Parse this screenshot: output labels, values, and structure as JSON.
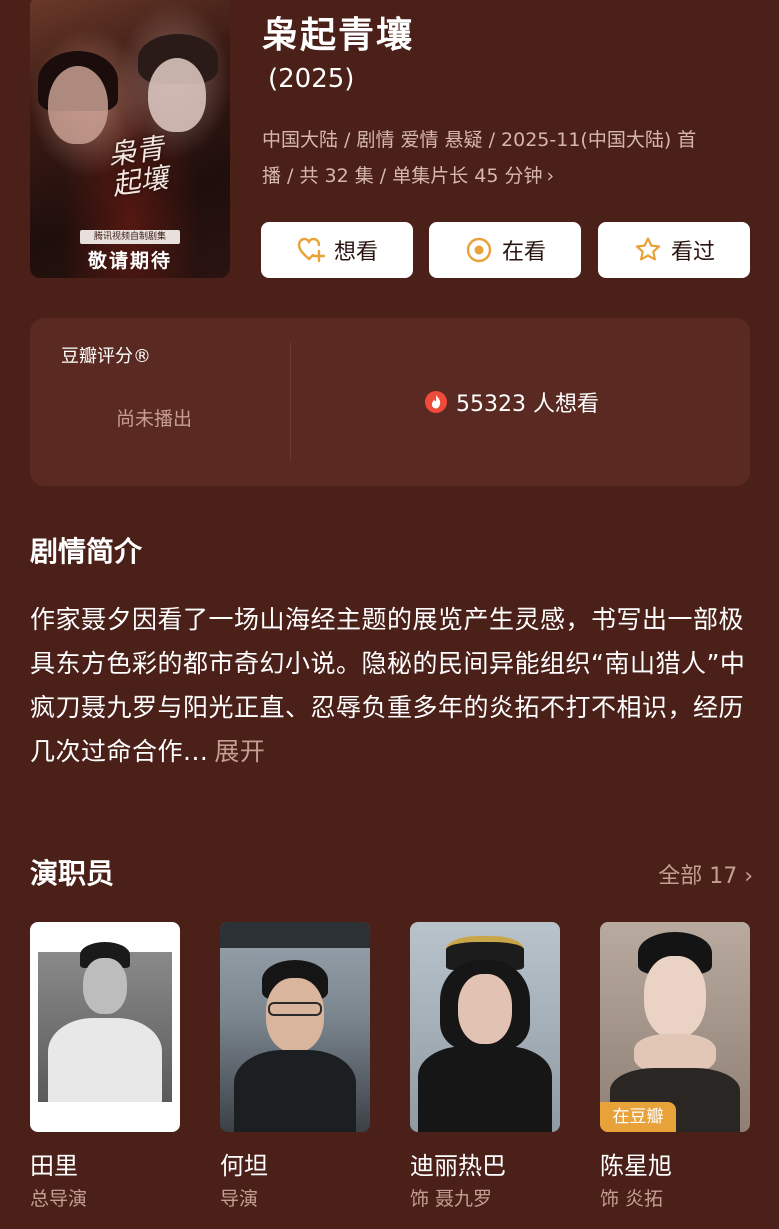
{
  "poster": {
    "calligraphy": "枭青起壤",
    "producer": "腾讯视频自制剧集",
    "coming_soon": "敬请期待"
  },
  "show": {
    "title": "枭起青壤",
    "year": "(2025)",
    "meta_line1": "中国大陆 / 剧情 爱情 悬疑 / 2025-11(中国大陆) 首",
    "meta_line2": "播 / 共 32 集 / 单集片长 45 分钟",
    "meta_chevron": "›"
  },
  "actions": [
    {
      "label": "想看",
      "icon": "heart-plus-icon"
    },
    {
      "label": "在看",
      "icon": "target-circle-icon"
    },
    {
      "label": "看过",
      "icon": "star-icon"
    }
  ],
  "rating": {
    "label": "豆瓣评分®",
    "status": "尚未播出",
    "wish_count": "55323 人想看",
    "wish_icon": "flame-icon"
  },
  "synopsis": {
    "heading": "剧情简介",
    "text": "作家聂夕因看了一场山海经主题的展览产生灵感，书写出一部极具东方色彩的都市奇幻小说。隐秘的民间异能组织“南山猎人”中疯刀聂九罗与阳光正直、忍辱负重多年的炎拓不打不相识，经历几次过命合作...",
    "expand": "展开"
  },
  "cast": {
    "heading": "演职员",
    "all_label": "全部 17 ›",
    "members": [
      {
        "name": "田里",
        "role": "总导演"
      },
      {
        "name": "何坦",
        "role": "导演"
      },
      {
        "name": "迪丽热巴",
        "role": "饰 聂九罗"
      },
      {
        "name": "陈星旭",
        "role": "饰 炎拓",
        "tag": "在豆瓣"
      }
    ]
  },
  "colors": {
    "background": "#4a2019",
    "panel": "#5a2a22",
    "muted_text": "#c59e92",
    "accent_orange": "#e8a23a",
    "flame_red": "#f04a3a"
  }
}
